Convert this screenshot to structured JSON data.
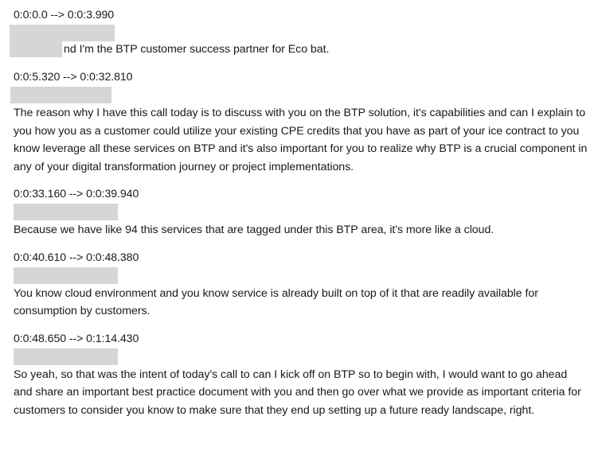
{
  "cues": [
    {
      "timestamp": "0:0:0.0 --> 0:0:3.990",
      "text": "nd I'm the BTP customer success partner for Eco bat."
    },
    {
      "timestamp": "0:0:5.320 --> 0:0:32.810",
      "text": "The reason why I have this call today is to discuss with you on the BTP solution, it's capabilities and can I explain to you how you as a customer could utilize your existing CPE credits that you have as part of your ice contract to you know leverage all these services on BTP and it's also important for you to realize why BTP is a crucial component in any of your digital transformation journey or project implementations."
    },
    {
      "timestamp": "0:0:33.160 --> 0:0:39.940",
      "text": "Because we have like 94 this services that are tagged under this BTP area, it's more like a cloud."
    },
    {
      "timestamp": "0:0:40.610 --> 0:0:48.380",
      "text": "You know cloud environment and you know service is already built on top of it that are readily available for consumption by customers."
    },
    {
      "timestamp": "0:0:48.650 --> 0:1:14.430",
      "text": "So yeah, so that was the intent of today's call to can I kick off on BTP so to begin with, I would want to go ahead and share an important best practice document with you and then go over what we provide as important criteria for customers to consider you know to make sure that they end up setting up a future ready landscape, right."
    }
  ]
}
